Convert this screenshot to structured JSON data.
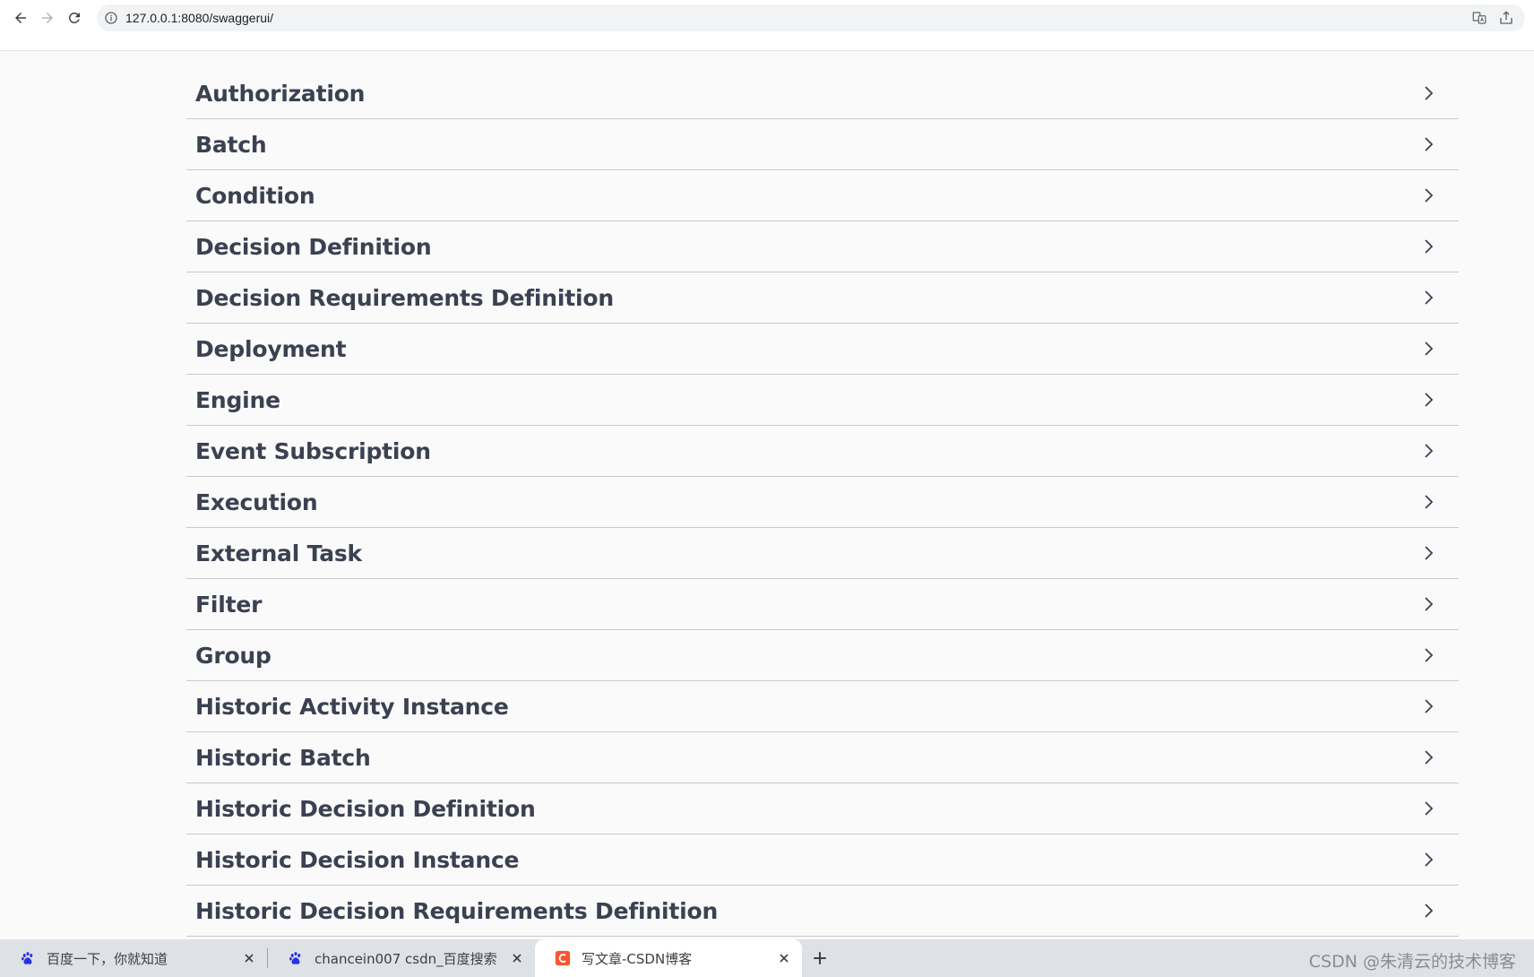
{
  "browser": {
    "url": "127.0.0.1:8080/swaggerui/"
  },
  "tags": [
    {
      "name": "Authorization"
    },
    {
      "name": "Batch"
    },
    {
      "name": "Condition"
    },
    {
      "name": "Decision Definition"
    },
    {
      "name": "Decision Requirements Definition"
    },
    {
      "name": "Deployment"
    },
    {
      "name": "Engine"
    },
    {
      "name": "Event Subscription"
    },
    {
      "name": "Execution"
    },
    {
      "name": "External Task"
    },
    {
      "name": "Filter"
    },
    {
      "name": "Group"
    },
    {
      "name": "Historic Activity Instance"
    },
    {
      "name": "Historic Batch"
    },
    {
      "name": "Historic Decision Definition"
    },
    {
      "name": "Historic Decision Instance"
    },
    {
      "name": "Historic Decision Requirements Definition"
    }
  ],
  "tabs": [
    {
      "title": "百度一下，你就知道",
      "icon": "baidu-paw-icon"
    },
    {
      "title": "chancein007 csdn_百度搜索",
      "icon": "baidu-paw-icon"
    },
    {
      "title": "写文章-CSDN博客",
      "icon": "csdn-logo-icon"
    }
  ],
  "watermark": "CSDN @朱清云的技术博客",
  "colors": {
    "tag_text": "#3b4151",
    "csdn_red": "#fc5531",
    "baidu_blue": "#2932e1"
  }
}
